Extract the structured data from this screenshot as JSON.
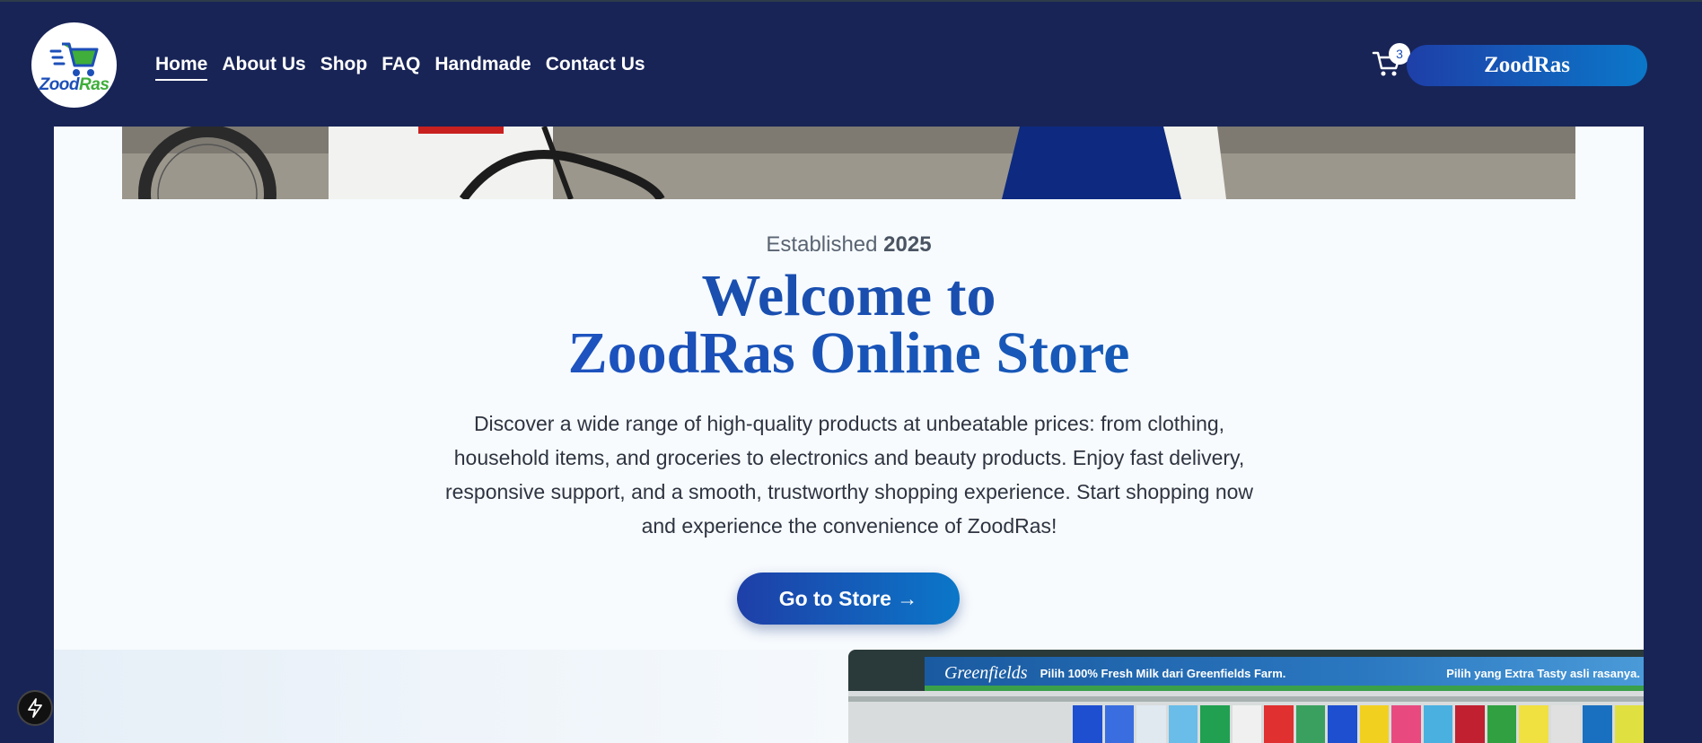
{
  "header": {
    "logo": {
      "part1": "Zood",
      "part2": "Ras"
    },
    "nav": [
      {
        "label": "Home",
        "active": true
      },
      {
        "label": "About Us"
      },
      {
        "label": "Shop"
      },
      {
        "label": "FAQ"
      },
      {
        "label": "Handmade"
      },
      {
        "label": "Contact Us"
      }
    ],
    "cart_count": "3",
    "brand_button": "ZoodRas"
  },
  "hero": {
    "established_prefix": "Established",
    "established_year": "2025",
    "title_line1": "Welcome to",
    "title_line2": "ZoodRas Online Store",
    "description": "Discover a wide range of high-quality products at unbeatable prices: from clothing, household items, and groceries to electronics and beauty products. Enjoy fast delivery, responsive support, and a smooth, trustworthy shopping experience. Start shopping now and experience the convenience of ZoodRas!",
    "cta": "Go to Store →"
  },
  "shelf_image": {
    "brand": "Greenfields",
    "tagline": "Pilih 100% Fresh Milk dari Greenfields Farm.",
    "tagline2": "Pilih yang Extra Tasty asli rasanya."
  },
  "colors": {
    "navy": "#182456",
    "accent_start": "#1e3fa8",
    "accent_end": "#0b77c8"
  }
}
